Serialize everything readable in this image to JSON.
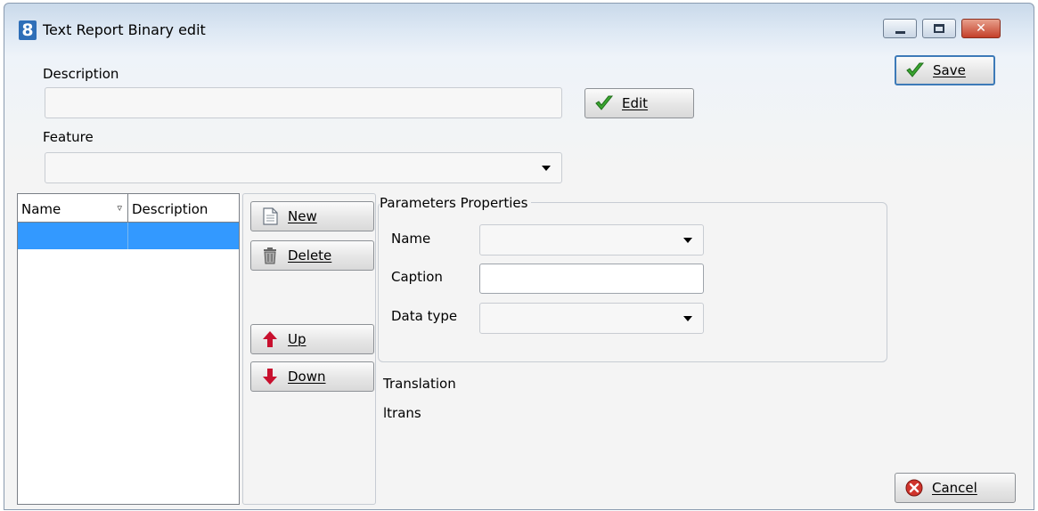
{
  "window": {
    "title": "Text Report Binary edit",
    "app_icon_glyph": "8"
  },
  "controls": {
    "minimize_glyph": "",
    "maximize_glyph": "",
    "close_glyph": "✕"
  },
  "description": {
    "label": "Description",
    "value": ""
  },
  "feature": {
    "label": "Feature",
    "value": ""
  },
  "buttons": {
    "edit": "Edit",
    "save": "Save",
    "new": "New",
    "delete": "Delete",
    "up": "Up",
    "down": "Down",
    "cancel": "Cancel"
  },
  "grid": {
    "columns": [
      "Name",
      "Description"
    ],
    "sort_glyph": "▿",
    "rows": [
      {
        "name": "",
        "description": ""
      }
    ]
  },
  "parameters": {
    "group_title": "Parameters Properties",
    "name_label": "Name",
    "name_value": "",
    "caption_label": "Caption",
    "caption_value": "",
    "datatype_label": "Data type",
    "datatype_value": ""
  },
  "translation": {
    "label": "Translation",
    "value": "ltrans"
  },
  "colors": {
    "selection": "#3399ff",
    "check_green": "#3aa530",
    "arrow_red": "#c8102e",
    "cancel_red": "#d0342c"
  },
  "icons": {
    "edit": "checkmark-icon",
    "save": "checkmark-icon",
    "new": "document-icon",
    "delete": "trash-icon",
    "up": "arrow-up-icon",
    "down": "arrow-down-icon",
    "cancel": "cancel-icon"
  }
}
